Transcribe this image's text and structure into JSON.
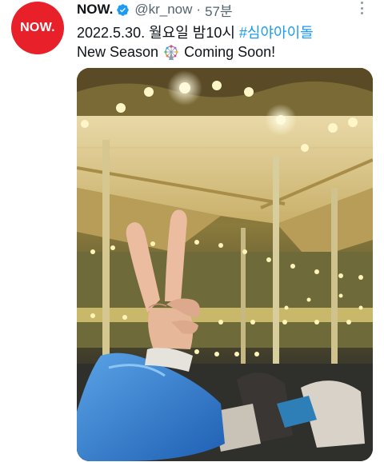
{
  "author": {
    "display_name": "NOW.",
    "avatar_text": "NOW.",
    "handle": "@kr_now",
    "separator": "·",
    "time": "57분",
    "verified": true
  },
  "tweet": {
    "line1_text": "2022.5.30. 월요일 밤10시 ",
    "hashtag": "#심야아이돌",
    "line2_before": "New Season",
    "line2_emoji_name": "ferris-wheel-icon",
    "line2_after": "Coming Soon!"
  },
  "media": {
    "description_icon": "carousel-photo"
  },
  "colors": {
    "brand_red": "#e8202a",
    "link_blue": "#1d9bf0",
    "secondary_text": "#536471",
    "primary_text": "#0f1419"
  }
}
